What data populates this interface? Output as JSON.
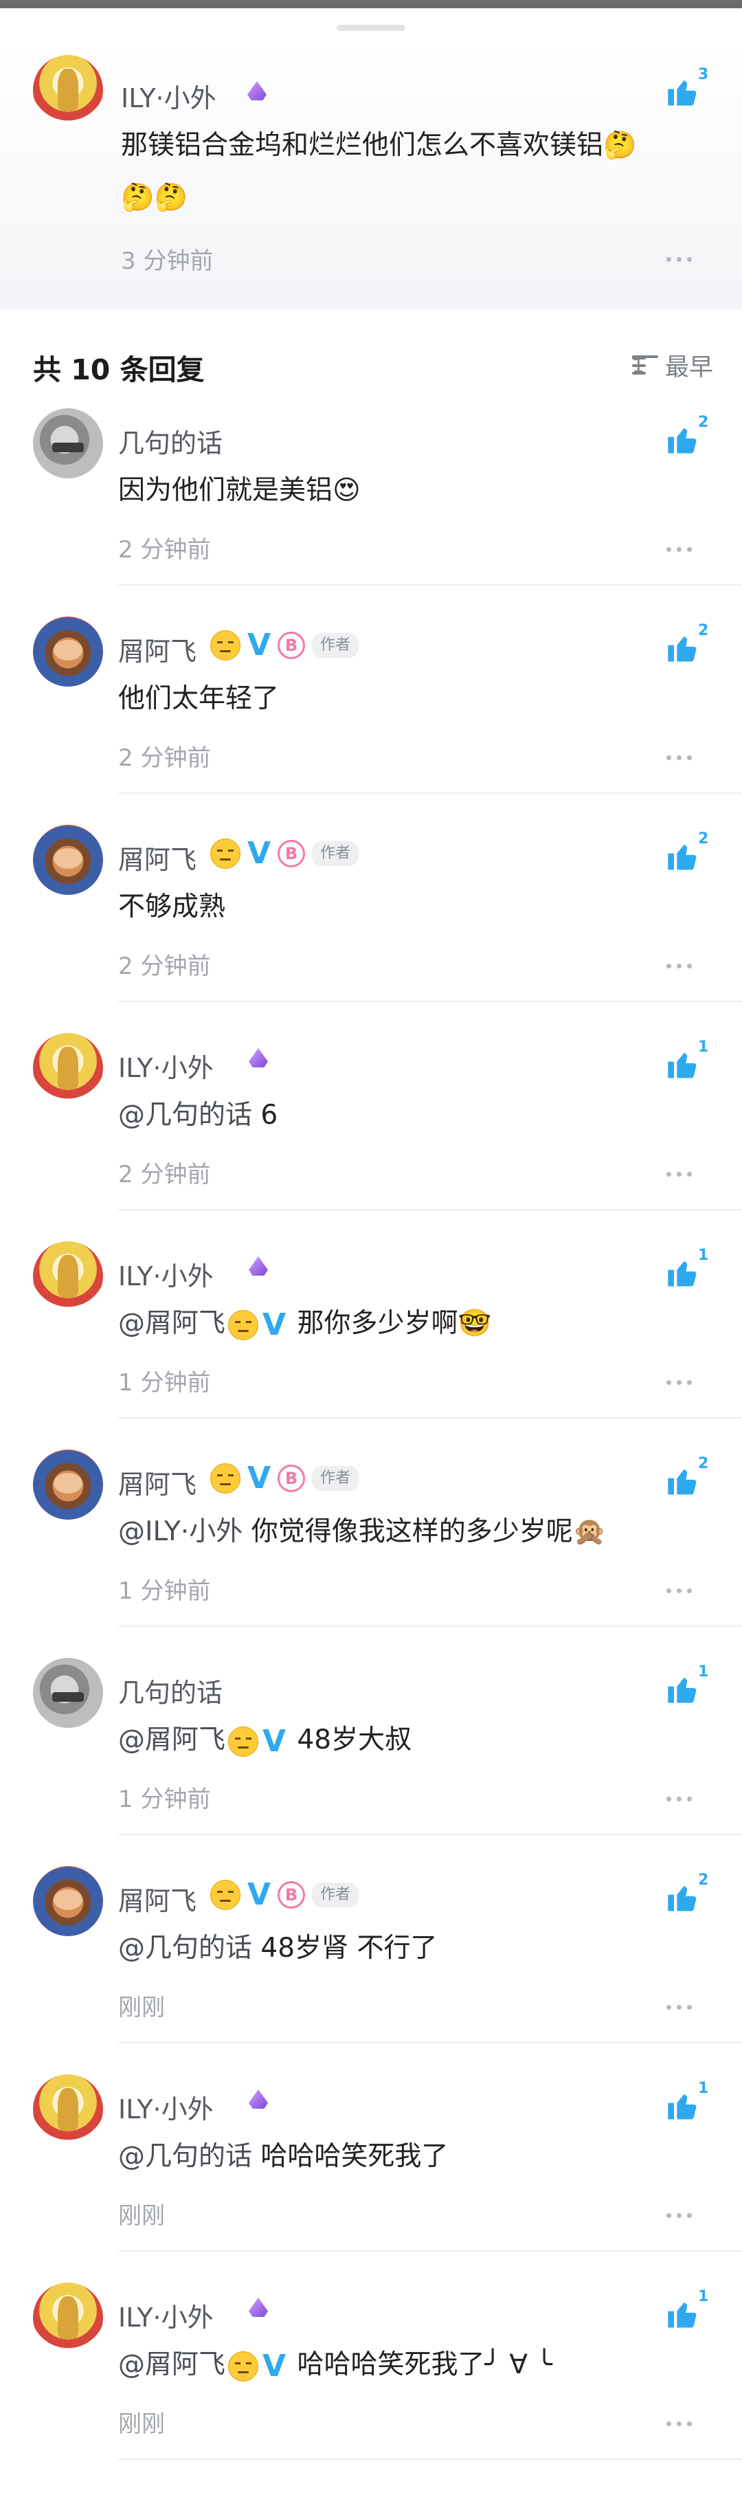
{
  "main_comment": {
    "user": "ILY·小外",
    "text_line1": "那镁铝合金坞和烂烂他们怎么不喜欢镁铝🤔",
    "text_line2": "🤔🤔",
    "time": "3 分钟前",
    "likes": "3"
  },
  "replies_header": {
    "title": "共 10 条回复",
    "sort_label": "最早"
  },
  "author_tag": "作者",
  "replies": [
    {
      "user": "几句的话",
      "mention": "",
      "text": "因为他们就是美铝😍",
      "time": "2 分钟前",
      "likes": "2"
    },
    {
      "user": "屑阿飞",
      "mention": "",
      "text": "他们太年轻了",
      "time": "2 分钟前",
      "likes": "2"
    },
    {
      "user": "屑阿飞",
      "mention": "",
      "text": "不够成熟",
      "time": "2 分钟前",
      "likes": "2"
    },
    {
      "user": "ILY·小外",
      "mention": "@几句的话",
      "text": "6",
      "time": "2 分钟前",
      "likes": "1"
    },
    {
      "user": "ILY·小外",
      "mention": "@屑阿飞",
      "text": "那你多少岁啊🤓",
      "time": "1 分钟前",
      "likes": "1"
    },
    {
      "user": "屑阿飞",
      "mention": "@ILY·小外",
      "text": "你觉得像我这样的多少岁呢🙊",
      "time": "1 分钟前",
      "likes": "2"
    },
    {
      "user": "几句的话",
      "mention": "@屑阿飞",
      "text": "48岁大叔",
      "time": "1 分钟前",
      "likes": "1"
    },
    {
      "user": "屑阿飞",
      "mention": "@几句的话",
      "text": "48岁肾 不行了",
      "time": "刚刚",
      "likes": "2"
    },
    {
      "user": "ILY·小外",
      "mention": "@几句的话",
      "text": "哈哈哈笑死我了",
      "time": "刚刚",
      "likes": "1"
    },
    {
      "user": "ILY·小外",
      "mention": "@屑阿飞",
      "text": "哈哈哈笑死我了╯ ∀ ╰",
      "time": "刚刚",
      "likes": "1"
    }
  ],
  "colors": {
    "accent": "#2ea9ef",
    "muted_text": "#a3a7ad",
    "author_badge": "#f37aa4"
  }
}
